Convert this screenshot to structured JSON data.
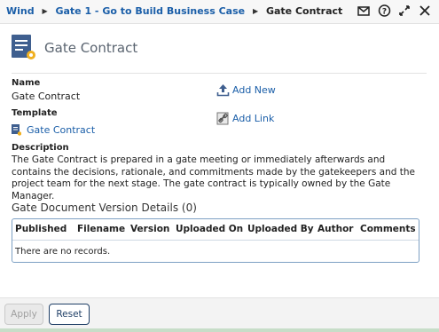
{
  "breadcrumb": {
    "items": [
      "Wind",
      "Gate 1 - Go to Build Business Case"
    ],
    "current": "Gate Contract"
  },
  "window_icons": [
    "mail-icon",
    "help-icon",
    "expand-icon",
    "close-icon"
  ],
  "page": {
    "title": "Gate Contract",
    "name_label": "Name",
    "name_value": "Gate Contract",
    "template_label": "Template",
    "template_value": "Gate Contract",
    "add_new_label": "Add New",
    "add_link_label": "Add Link",
    "description_label": "Description",
    "description_text": "The Gate Contract is prepared in a gate meeting or immediately afterwards and contains the decisions, rationale, and commitments made by the gatekeepers and the project team for the next stage. The gate contract is typically owned by the Gate Manager."
  },
  "versions": {
    "title": "Gate Document Version Details (0)",
    "columns": [
      "Published",
      "Filename",
      "Version",
      "Uploaded On",
      "Uploaded By",
      "Author",
      "Comments"
    ],
    "empty_text": "There are no records."
  },
  "footer": {
    "apply_label": "Apply",
    "reset_label": "Reset"
  },
  "colors": {
    "link": "#1a5ea8",
    "doc_icon": "#3f5f8f",
    "doc_icon_badge": "#f0b020",
    "grid_border": "#7da0c4"
  }
}
